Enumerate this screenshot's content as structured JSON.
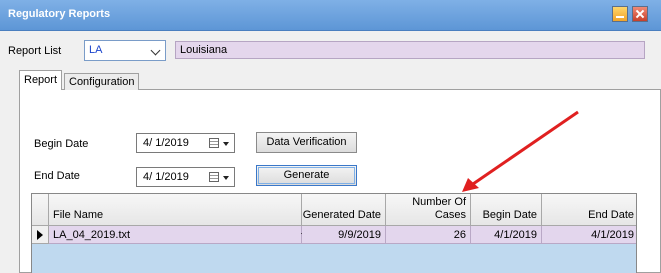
{
  "window": {
    "title": "Regulatory Reports"
  },
  "report_list": {
    "label": "Report List",
    "selected": "LA",
    "name": "Louisiana"
  },
  "tabs": [
    {
      "label": "Report"
    },
    {
      "label": "Configuration"
    }
  ],
  "begin_date": {
    "label": "Begin Date",
    "value": "4/ 1/2019"
  },
  "end_date": {
    "label": "End Date",
    "value": "4/ 1/2019"
  },
  "buttons": {
    "data_verification": "Data Verification",
    "generate": "Generate"
  },
  "grid": {
    "columns": [
      "File Name",
      "Generated Date",
      "Number Of Cases",
      "Begin Date",
      "End Date"
    ],
    "columns_display": {
      "cases_line1": "Number Of",
      "cases_line2": "Cases"
    },
    "rows": [
      {
        "file_name": "LA_04_2019.txt",
        "generated_date": "9/9/2019",
        "number_of_cases": "26",
        "begin_date": "4/1/2019",
        "end_date": "4/1/2019"
      }
    ]
  },
  "annotation": {
    "arrow_color": "#e02020"
  }
}
